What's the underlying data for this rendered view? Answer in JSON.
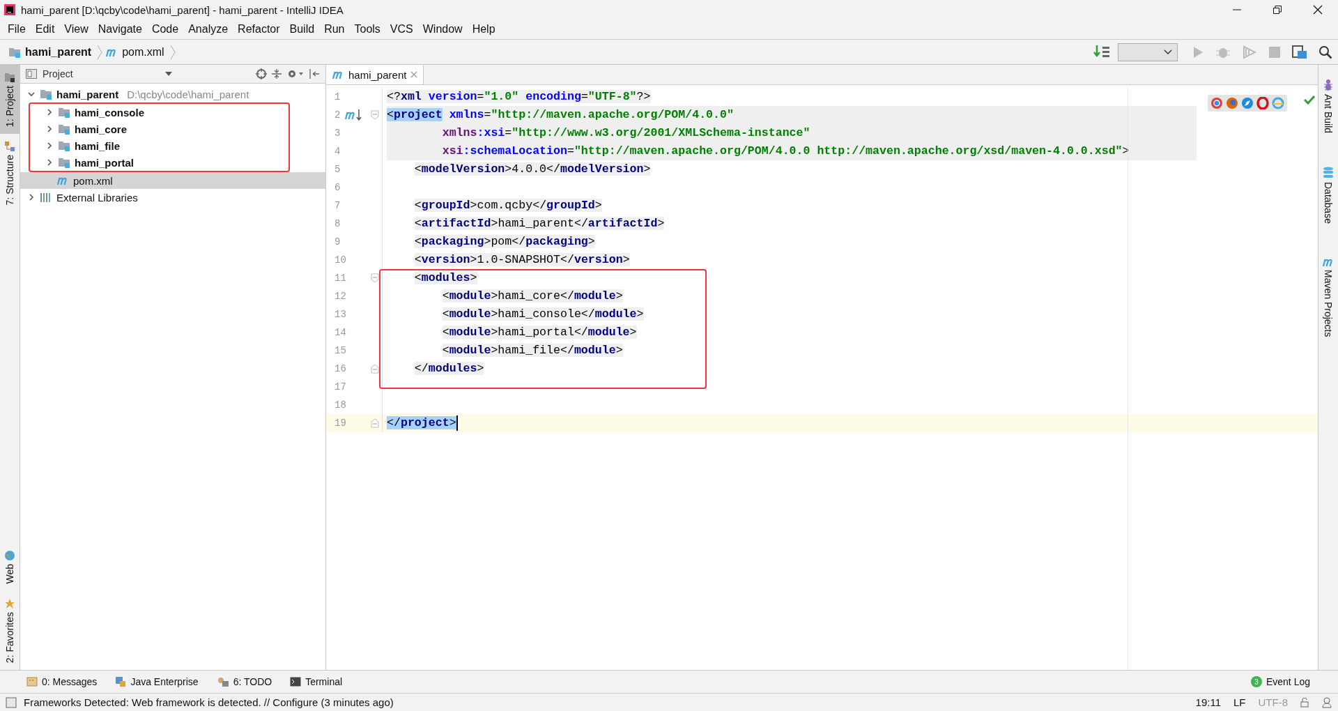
{
  "window": {
    "title": "hami_parent [D:\\qcby\\code\\hami_parent] - hami_parent - IntelliJ IDEA"
  },
  "menu": [
    "File",
    "Edit",
    "View",
    "Navigate",
    "Code",
    "Analyze",
    "Refactor",
    "Build",
    "Run",
    "Tools",
    "VCS",
    "Window",
    "Help"
  ],
  "breadcrumbs": [
    {
      "label": "hami_parent",
      "kind": "module"
    },
    {
      "label": "pom.xml",
      "kind": "maven-file"
    }
  ],
  "left_tool_windows": [
    {
      "label": "1: Project",
      "kind": "project",
      "selected": true
    },
    {
      "label": "7: Structure",
      "kind": "structure",
      "selected": false
    },
    {
      "label": "Web",
      "kind": "web",
      "selected": false
    },
    {
      "label": "2: Favorites",
      "kind": "favorites",
      "selected": false
    }
  ],
  "right_tool_windows": [
    {
      "label": "Ant Build",
      "kind": "ant"
    },
    {
      "label": "Database",
      "kind": "database"
    },
    {
      "label": "Maven Projects",
      "kind": "maven"
    }
  ],
  "project_panel": {
    "title": "Project",
    "tree": [
      {
        "name": "hami_parent",
        "path": "D:\\qcby\\code\\hami_parent",
        "kind": "module",
        "expanded": true,
        "selected": false,
        "outlined": false,
        "children": [
          {
            "name": "hami_console",
            "kind": "module",
            "expanded": false,
            "selected": false,
            "outlined": true
          },
          {
            "name": "hami_core",
            "kind": "module",
            "expanded": false,
            "selected": false,
            "outlined": true
          },
          {
            "name": "hami_file",
            "kind": "module",
            "expanded": false,
            "selected": false,
            "outlined": true
          },
          {
            "name": "hami_portal",
            "kind": "module",
            "expanded": false,
            "selected": false,
            "outlined": true
          },
          {
            "name": "pom.xml",
            "kind": "maven-file",
            "selected": true,
            "outlined": false
          }
        ]
      },
      {
        "name": "External Libraries",
        "kind": "library",
        "expanded": false,
        "selected": false,
        "outlined": false
      }
    ]
  },
  "editor": {
    "tabs": [
      {
        "label": "hami_parent",
        "selected": true
      }
    ],
    "lines": [
      {
        "number": "1",
        "text": "<?xml version=\"1.0\" encoding=\"UTF-8\"?>",
        "shaded": false,
        "current": false,
        "outlined": false
      },
      {
        "number": "2",
        "text": "<project xmlns=\"http://maven.apache.org/POM/4.0.0\"",
        "shaded": true,
        "current": false,
        "outlined": false,
        "fold_start": true,
        "maven_marker": true,
        "bracket_match": true
      },
      {
        "number": "3",
        "text": "        xmlns:xsi=\"http://www.w3.org/2001/XMLSchema-instance\"",
        "shaded": true,
        "current": false,
        "outlined": false
      },
      {
        "number": "4",
        "text": "        xsi:schemaLocation=\"http://maven.apache.org/POM/4.0.0 http://maven.apache.org/xsd/maven-4.0.0.xsd\">",
        "shaded": true,
        "current": false,
        "outlined": false
      },
      {
        "number": "5",
        "text": "    <modelVersion>4.0.0</modelVersion>",
        "shaded": false,
        "current": false,
        "outlined": false
      },
      {
        "number": "6",
        "shaded": false,
        "current": false,
        "outlined": false
      },
      {
        "number": "7",
        "text": "    <groupId>com.qcby</groupId>",
        "shaded": false,
        "current": false,
        "outlined": false
      },
      {
        "number": "8",
        "text": "    <artifactId>hami_parent</artifactId>",
        "shaded": false,
        "current": false,
        "outlined": false
      },
      {
        "number": "9",
        "text": "    <packaging>pom</packaging>",
        "shaded": false,
        "current": false,
        "outlined": false
      },
      {
        "number": "10",
        "text": "    <version>1.0-SNAPSHOT</version>",
        "shaded": false,
        "current": false,
        "outlined": false
      },
      {
        "number": "11",
        "text": "    <modules>",
        "shaded": false,
        "current": false,
        "outlined": true,
        "fold_start": true
      },
      {
        "number": "12",
        "text": "        <module>hami_core</module>",
        "shaded": false,
        "current": false,
        "outlined": true
      },
      {
        "number": "13",
        "text": "        <module>hami_console</module>",
        "shaded": false,
        "current": false,
        "outlined": true
      },
      {
        "number": "14",
        "text": "        <module>hami_portal</module>",
        "shaded": false,
        "current": false,
        "outlined": true
      },
      {
        "number": "15",
        "text": "        <module>hami_file</module>",
        "shaded": false,
        "current": false,
        "outlined": true
      },
      {
        "number": "16",
        "text": "    </modules>",
        "shaded": false,
        "current": false,
        "outlined": true,
        "fold_end": true
      },
      {
        "number": "17",
        "shaded": false,
        "current": false,
        "outlined": true
      },
      {
        "number": "18",
        "shaded": false,
        "current": false,
        "outlined": false
      },
      {
        "number": "19",
        "text": "</project>",
        "shaded": false,
        "current": true,
        "outlined": false,
        "fold_end": true,
        "bracket_match": true
      }
    ]
  },
  "bottom_tool_windows": [
    {
      "label": "0: Messages",
      "kind": "messages"
    },
    {
      "label": "Java Enterprise",
      "kind": "enterprise"
    },
    {
      "label": "6: TODO",
      "kind": "todo"
    },
    {
      "label": "Terminal",
      "kind": "terminal"
    }
  ],
  "event_log": {
    "label": "Event Log",
    "count": "3"
  },
  "status_bar": {
    "message": "Frameworks Detected: Web framework is detected. // Configure (3 minutes ago)",
    "position": "19:11",
    "line_separator": "LF",
    "encoding": {
      "label": "UTF-8",
      "disabled": true
    }
  }
}
